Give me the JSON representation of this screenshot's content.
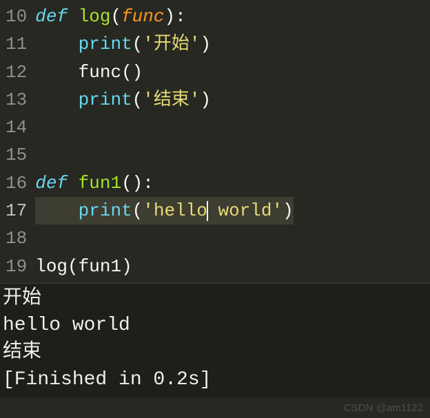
{
  "editor": {
    "lines": [
      {
        "num": "10",
        "active": false,
        "tokens": [
          {
            "cls": "tok-keyword",
            "t": "def"
          },
          {
            "cls": "tok-plain",
            "t": " "
          },
          {
            "cls": "tok-funcname",
            "t": "log"
          },
          {
            "cls": "tok-punct",
            "t": "("
          },
          {
            "cls": "tok-param",
            "t": "func"
          },
          {
            "cls": "tok-punct",
            "t": "):"
          }
        ]
      },
      {
        "num": "11",
        "active": false,
        "tokens": [
          {
            "cls": "tok-plain",
            "t": "    "
          },
          {
            "cls": "tok-call",
            "t": "print"
          },
          {
            "cls": "tok-punct",
            "t": "("
          },
          {
            "cls": "tok-string",
            "t": "'开始'"
          },
          {
            "cls": "tok-punct",
            "t": ")"
          }
        ]
      },
      {
        "num": "12",
        "active": false,
        "tokens": [
          {
            "cls": "tok-plain",
            "t": "    "
          },
          {
            "cls": "tok-plain",
            "t": "func"
          },
          {
            "cls": "tok-punct",
            "t": "()"
          }
        ]
      },
      {
        "num": "13",
        "active": false,
        "tokens": [
          {
            "cls": "tok-plain",
            "t": "    "
          },
          {
            "cls": "tok-call",
            "t": "print"
          },
          {
            "cls": "tok-punct",
            "t": "("
          },
          {
            "cls": "tok-string",
            "t": "'结束'"
          },
          {
            "cls": "tok-punct",
            "t": ")"
          }
        ]
      },
      {
        "num": "14",
        "active": false,
        "tokens": []
      },
      {
        "num": "15",
        "active": false,
        "tokens": []
      },
      {
        "num": "16",
        "active": false,
        "tokens": [
          {
            "cls": "tok-keyword",
            "t": "def"
          },
          {
            "cls": "tok-plain",
            "t": " "
          },
          {
            "cls": "tok-funcname",
            "t": "fun1"
          },
          {
            "cls": "tok-punct",
            "t": "():"
          }
        ]
      },
      {
        "num": "17",
        "active": true,
        "tokens": [
          {
            "cls": "tok-plain",
            "t": "    "
          },
          {
            "cls": "tok-call",
            "t": "print"
          },
          {
            "cls": "tok-punct",
            "t": "("
          },
          {
            "cls": "tok-string",
            "t": "'hello"
          },
          {
            "cls": "cursor",
            "t": ""
          },
          {
            "cls": "tok-string",
            "t": " world'"
          },
          {
            "cls": "tok-punct",
            "t": ")"
          }
        ]
      },
      {
        "num": "18",
        "active": false,
        "tokens": []
      },
      {
        "num": "19",
        "active": false,
        "tokens": [
          {
            "cls": "tok-plain",
            "t": "log"
          },
          {
            "cls": "tok-punct",
            "t": "("
          },
          {
            "cls": "tok-plain",
            "t": "fun1"
          },
          {
            "cls": "tok-punct",
            "t": ")"
          }
        ]
      }
    ]
  },
  "console": {
    "lines": [
      "开始",
      "hello world",
      "结束",
      "[Finished in 0.2s]"
    ]
  },
  "watermark": "CSDN @am1122"
}
